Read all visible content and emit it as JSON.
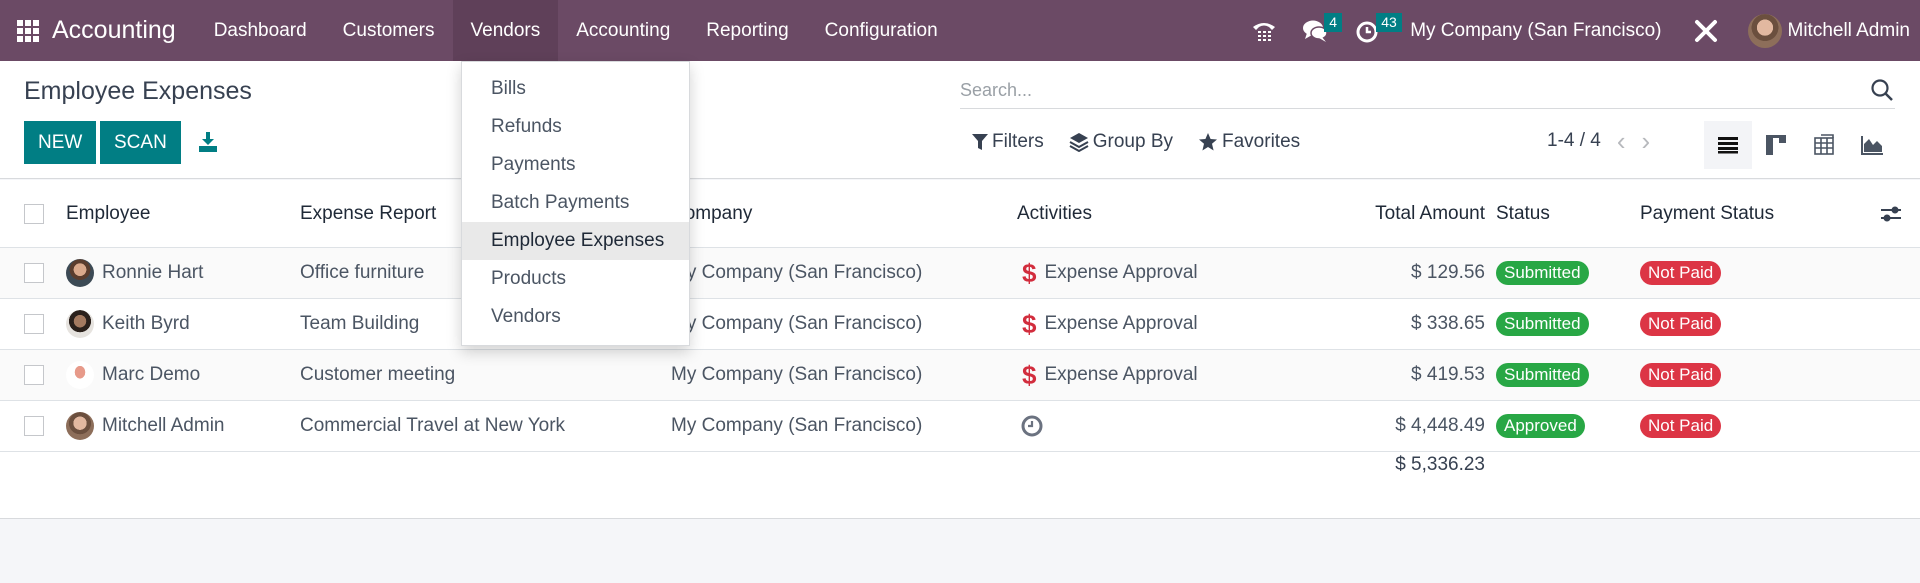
{
  "navbar": {
    "app_name": "Accounting",
    "menu": [
      "Dashboard",
      "Customers",
      "Vendors",
      "Accounting",
      "Reporting",
      "Configuration"
    ],
    "open_menu": "Vendors",
    "messages_count": "4",
    "activities_count": "43",
    "company": "My Company (San Francisco)",
    "user": "Mitchell Admin",
    "icons": [
      "apps-grid-icon",
      "phone-icon",
      "chat-icon",
      "clock-icon",
      "tools-icon"
    ]
  },
  "control_panel": {
    "title": "Employee Expenses",
    "new_label": "NEW",
    "scan_label": "SCAN",
    "search_placeholder": "Search...",
    "filters_label": "Filters",
    "group_by_label": "Group By",
    "favorites_label": "Favorites",
    "pager": "1-4 / 4",
    "views": [
      "list",
      "kanban",
      "pivot",
      "graph"
    ],
    "active_view": "list"
  },
  "dropdown": {
    "items": [
      "Bills",
      "Refunds",
      "Payments",
      "Batch Payments",
      "Employee Expenses",
      "Products",
      "Vendors"
    ],
    "active": "Employee Expenses"
  },
  "table": {
    "columns": [
      "Employee",
      "Expense Report",
      "Company",
      "Activities",
      "Total Amount",
      "Status",
      "Payment Status"
    ],
    "rows": [
      {
        "employee": "Ronnie Hart",
        "report": "Office furniture",
        "company": "My Company (San Francisco)",
        "activity": "Expense Approval",
        "activity_icon": "dollar-icon",
        "amount": "$ 129.56",
        "status": "Submitted",
        "payment_status": "Not Paid"
      },
      {
        "employee": "Keith Byrd",
        "report": "Team Building",
        "company": "My Company (San Francisco)",
        "activity": "Expense Approval",
        "activity_icon": "dollar-icon",
        "amount": "$ 338.65",
        "status": "Submitted",
        "payment_status": "Not Paid"
      },
      {
        "employee": "Marc Demo",
        "report": "Customer meeting",
        "company": "My Company (San Francisco)",
        "activity": "Expense Approval",
        "activity_icon": "dollar-icon",
        "amount": "$ 419.53",
        "status": "Submitted",
        "payment_status": "Not Paid"
      },
      {
        "employee": "Mitchell Admin",
        "report": "Commercial Travel at New York",
        "company": "My Company (San Francisco)",
        "activity": "",
        "activity_icon": "clock-icon",
        "amount": "$ 4,448.49",
        "status": "Approved",
        "payment_status": "Not Paid"
      }
    ],
    "total": "$ 5,336.23"
  },
  "colors": {
    "navbar": "#6b4a65",
    "primary": "#017e84",
    "success": "#28a745",
    "danger": "#dc3545"
  }
}
